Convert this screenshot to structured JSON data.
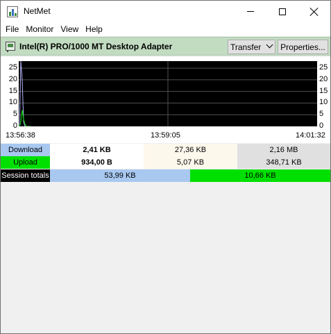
{
  "window": {
    "title": "NetMet"
  },
  "menu": [
    "File",
    "Monitor",
    "View",
    "Help"
  ],
  "toolbar": {
    "adapter": "Intel(R) PRO/1000 MT Desktop Adapter",
    "mode": "Transfer",
    "properties_label": "Properties..."
  },
  "chart_data": {
    "type": "line",
    "x": [
      0,
      1,
      2,
      3,
      4,
      5,
      6,
      7,
      8
    ],
    "x_tick_labels": [
      "13:56:38",
      "13:59:05",
      "14:01:32"
    ],
    "y_ticks": [
      0,
      5,
      10,
      15,
      20,
      25
    ],
    "ylim": [
      0,
      28
    ],
    "series": [
      {
        "color": "#b4b4ff",
        "values": [
          0,
          28,
          20,
          2,
          0,
          0,
          0,
          0,
          0
        ]
      },
      {
        "color": "#00e000",
        "values": [
          0,
          2,
          7,
          3,
          1,
          0,
          0,
          0,
          0
        ]
      }
    ],
    "grid": true,
    "background": "#000000"
  },
  "stats": {
    "download": {
      "label": "Download",
      "current": "2,41 KB",
      "v2": "27,36 KB",
      "v3": "2,16 MB",
      "label_bg": "#a8c8f0"
    },
    "upload": {
      "label": "Upload",
      "current": "934,00 B",
      "v2": "5,07 KB",
      "v3": "348,71 KB",
      "label_bg": "#00e000"
    },
    "session": {
      "label": "Session totals",
      "download": "53,99 KB",
      "upload": "10,66 KB"
    }
  }
}
